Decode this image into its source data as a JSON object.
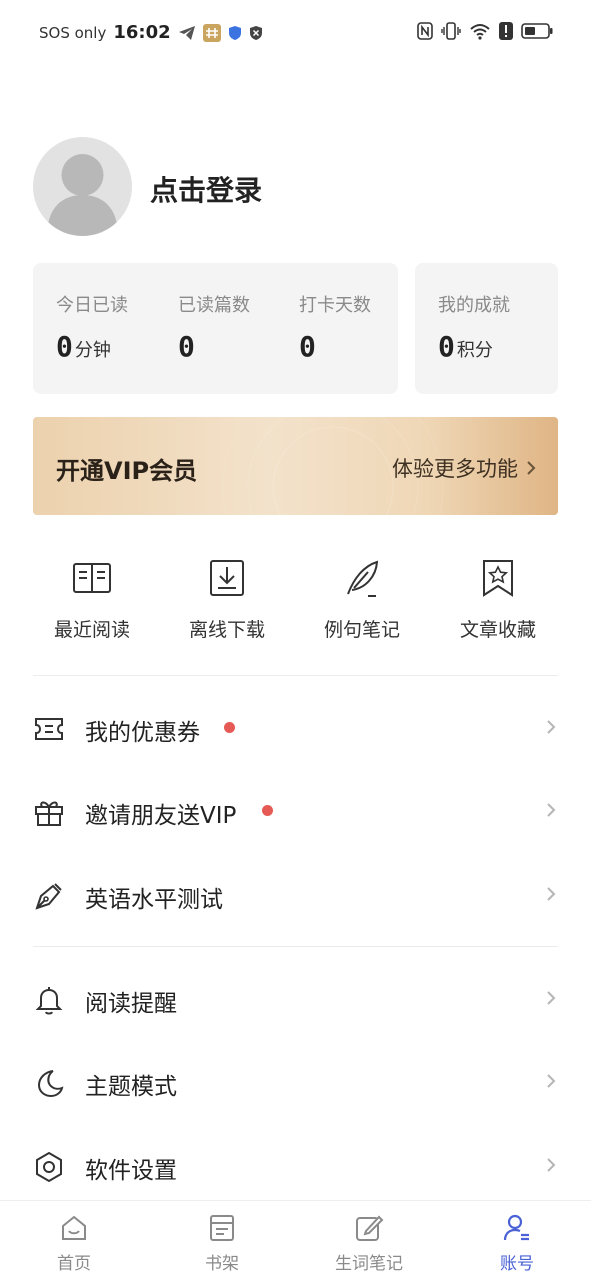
{
  "status_bar": {
    "carrier": "SOS only",
    "time": "16:02"
  },
  "profile": {
    "login_label": "点击登录"
  },
  "stats": [
    {
      "label": "今日已读",
      "value": "0",
      "unit": "分钟"
    },
    {
      "label": "已读篇数",
      "value": "0",
      "unit": ""
    },
    {
      "label": "打卡天数",
      "value": "0",
      "unit": ""
    }
  ],
  "achievement": {
    "label": "我的成就",
    "value": "0",
    "unit": "积分"
  },
  "vip": {
    "title": "开通VIP会员",
    "cta": "体验更多功能"
  },
  "quick_actions": [
    {
      "label": "最近阅读",
      "icon": "open-book-icon"
    },
    {
      "label": "离线下载",
      "icon": "download-icon"
    },
    {
      "label": "例句笔记",
      "icon": "feather-icon"
    },
    {
      "label": "文章收藏",
      "icon": "bookmark-star-icon"
    }
  ],
  "menu": [
    {
      "label": "我的优惠券",
      "icon": "ticket-icon",
      "badge": true
    },
    {
      "label": "邀请朋友送VIP",
      "icon": "gift-icon",
      "badge": true
    },
    {
      "label": "英语水平测试",
      "icon": "pen-nib-icon",
      "badge": false
    },
    {
      "label": "阅读提醒",
      "icon": "bell-icon",
      "badge": false
    },
    {
      "label": "主题模式",
      "icon": "moon-icon",
      "badge": false
    },
    {
      "label": "软件设置",
      "icon": "settings-hexagon-icon",
      "badge": false
    }
  ],
  "bottom_nav": [
    {
      "label": "首页",
      "icon": "home-icon",
      "active": false
    },
    {
      "label": "书架",
      "icon": "bookshelf-icon",
      "active": false
    },
    {
      "label": "生词笔记",
      "icon": "edit-note-icon",
      "active": false
    },
    {
      "label": "账号",
      "icon": "account-icon",
      "active": true
    }
  ],
  "colors": {
    "accent": "#4a62d6",
    "badge": "#e55a55",
    "card_bg": "#f4f4f4",
    "vip_gold": "#dfb585"
  }
}
